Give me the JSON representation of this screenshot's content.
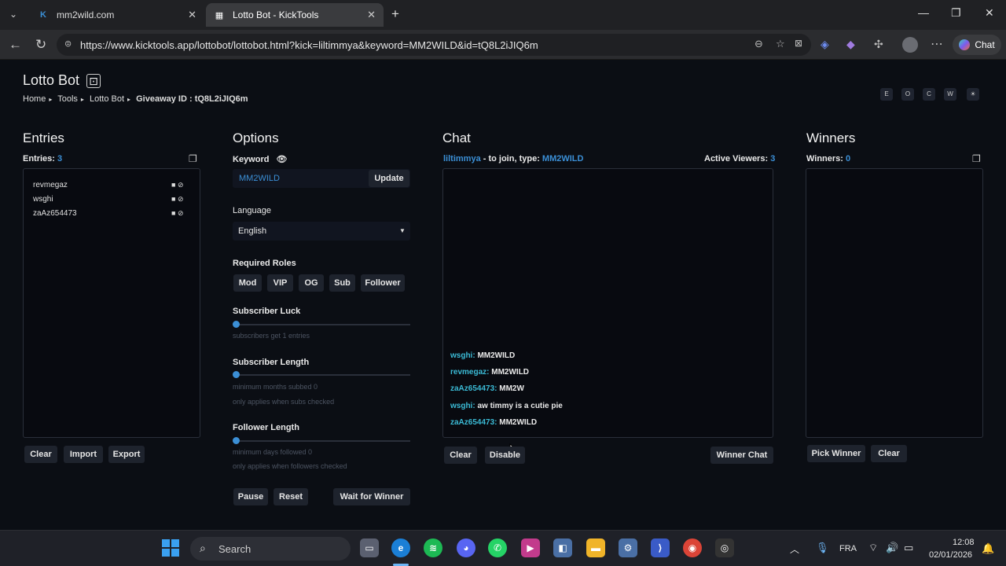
{
  "browser": {
    "tabs": [
      {
        "title": "mm2wild.com",
        "favicon": "K"
      },
      {
        "title": "Lotto Bot - KickTools",
        "favicon": "grid"
      }
    ],
    "url": "https://www.kicktools.app/lottobot/lottobot.html?kick=liltimmya&keyword=MM2WILD&id=tQ8L2iJIQ6m",
    "chat_button": "Chat"
  },
  "page": {
    "title": "Lotto Bot",
    "breadcrumb": [
      "Home",
      "Tools",
      "Lotto Bot",
      "Giveaway ID : tQ8L2iJIQ6m"
    ],
    "toggles": [
      "E",
      "O",
      "C",
      "W",
      "☀"
    ]
  },
  "entries": {
    "title": "Entries",
    "count_label": "Entries:",
    "count": "3",
    "list": [
      "revmegaz",
      "wsghi",
      "zaAz654473"
    ],
    "buttons": {
      "clear": "Clear",
      "import": "Import",
      "export": "Export"
    }
  },
  "options": {
    "title": "Options",
    "keyword_label": "Keyword",
    "keyword_value": "MM2WILD",
    "update_button": "Update",
    "language_label": "Language",
    "language_value": "English",
    "roles_label": "Required Roles",
    "roles": [
      "Mod",
      "VIP",
      "OG",
      "Sub",
      "Follower"
    ],
    "sub_luck": {
      "label": "Subscriber Luck",
      "hint": "subscribers get 1 entries",
      "level": 0
    },
    "sub_length": {
      "label": "Subscriber Length",
      "hint1": "minimum months subbed 0",
      "hint2": "only applies when subs checked",
      "level": 0
    },
    "follower_length": {
      "label": "Follower Length",
      "hint1": "minimum days followed 0",
      "hint2": "only applies when followers checked",
      "level": 0
    },
    "buttons": {
      "pause": "Pause",
      "reset": "Reset",
      "wait": "Wait for Winner"
    }
  },
  "chat": {
    "title": "Chat",
    "streamer": "liltimmya",
    "join_text": "- to join, type:",
    "keyword": "MM2WILD",
    "viewers_label": "Active Viewers:",
    "viewers": "3",
    "messages": [
      {
        "user": "wsghi:",
        "text": "MM2WILD"
      },
      {
        "user": "revmegaz:",
        "text": "MM2WILD"
      },
      {
        "user": "zaAz654473:",
        "text": "MM2W"
      },
      {
        "user": "wsghi:",
        "text": "aw timmy is a cutie pie"
      },
      {
        "user": "zaAz654473:",
        "text": "MM2WILD"
      }
    ],
    "buttons": {
      "clear": "Clear",
      "disable": "Disable",
      "winner_chat": "Winner Chat"
    }
  },
  "winners": {
    "title": "Winners",
    "count_label": "Winners:",
    "count": "0",
    "buttons": {
      "pick": "Pick Winner",
      "clear": "Clear"
    }
  },
  "taskbar": {
    "search": "Search",
    "lang": "FRA",
    "time": "12:08",
    "date": "02/01/2026"
  }
}
